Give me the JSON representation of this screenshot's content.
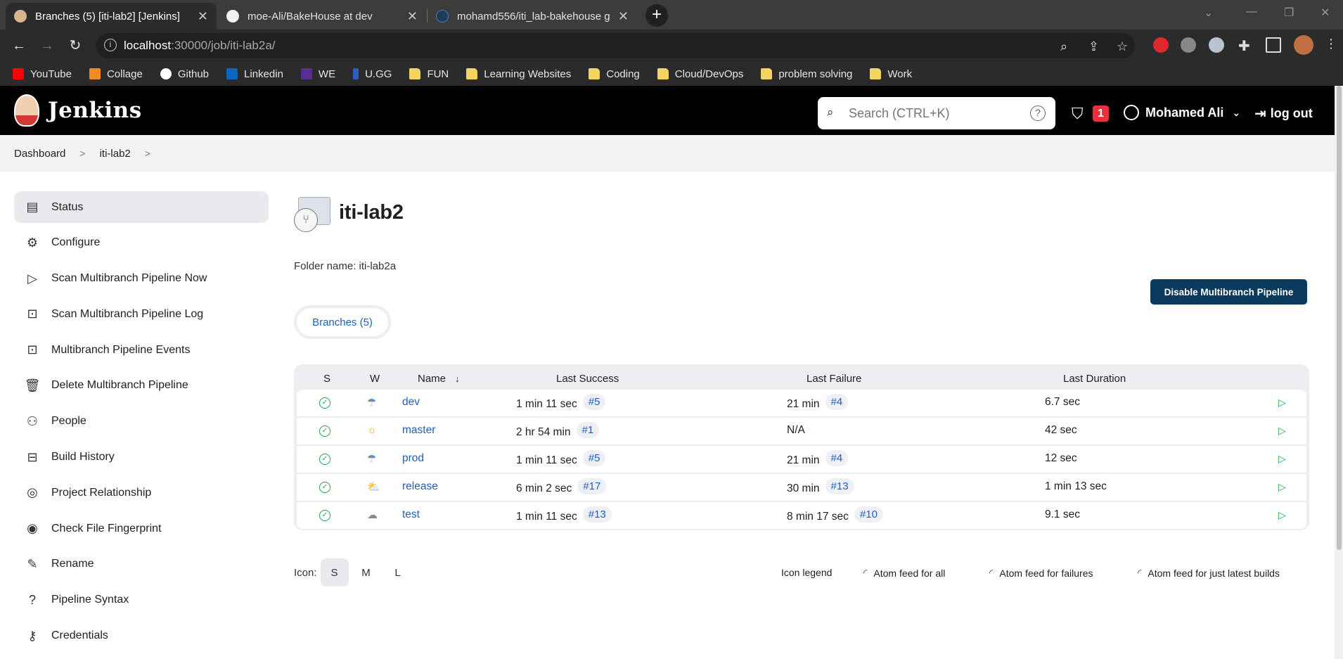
{
  "browser": {
    "tabs": [
      {
        "title": "Branches (5) [iti-lab2] [Jenkins]",
        "active": true
      },
      {
        "title": "moe-Ali/BakeHouse at dev",
        "active": false
      },
      {
        "title": "mohamd556/iti_lab-bakehouse g",
        "active": false
      }
    ],
    "new_tab": "+",
    "url_host": "localhost",
    "url_rest": ":30000/job/iti-lab2a/",
    "bookmarks": [
      {
        "label": "YouTube",
        "icon": "youtube-icon"
      },
      {
        "label": "Collage",
        "icon": "collage-icon"
      },
      {
        "label": "Github",
        "icon": "github-icon"
      },
      {
        "label": "Linkedin",
        "icon": "linkedin-icon"
      },
      {
        "label": "WE",
        "icon": "we-icon"
      },
      {
        "label": "U.GG",
        "icon": "ugg-icon"
      },
      {
        "label": "FUN",
        "icon": "folder-icon"
      },
      {
        "label": "Learning Websites",
        "icon": "folder-icon"
      },
      {
        "label": "Coding",
        "icon": "folder-icon"
      },
      {
        "label": "Cloud/DevOps",
        "icon": "folder-icon"
      },
      {
        "label": "problem solving",
        "icon": "folder-icon"
      },
      {
        "label": "Work",
        "icon": "folder-icon"
      }
    ]
  },
  "header": {
    "brand": "Jenkins",
    "search_placeholder": "Search (CTRL+K)",
    "alert_count": "1",
    "user": "Mohamed Ali",
    "logout": "log out"
  },
  "breadcrumb": [
    "Dashboard",
    "iti-lab2"
  ],
  "sidebar": {
    "items": [
      {
        "label": "Status",
        "icon": "status-icon",
        "active": true
      },
      {
        "label": "Configure",
        "icon": "gear-icon"
      },
      {
        "label": "Scan Multibranch Pipeline Now",
        "icon": "play-icon"
      },
      {
        "label": "Scan Multibranch Pipeline Log",
        "icon": "terminal-icon"
      },
      {
        "label": "Multibranch Pipeline Events",
        "icon": "terminal-icon"
      },
      {
        "label": "Delete Multibranch Pipeline",
        "icon": "trash-icon"
      },
      {
        "label": "People",
        "icon": "people-icon"
      },
      {
        "label": "Build History",
        "icon": "history-icon"
      },
      {
        "label": "Project Relationship",
        "icon": "relationship-icon"
      },
      {
        "label": "Check File Fingerprint",
        "icon": "fingerprint-icon"
      },
      {
        "label": "Rename",
        "icon": "pencil-icon"
      },
      {
        "label": "Pipeline Syntax",
        "icon": "help-icon"
      },
      {
        "label": "Credentials",
        "icon": "key-icon"
      }
    ]
  },
  "main": {
    "title": "iti-lab2",
    "folder_name": "Folder name: iti-lab2a",
    "disable_button": "Disable Multibranch Pipeline",
    "branches_tab": "Branches (5)",
    "columns": {
      "s": "S",
      "w": "W",
      "name": "Name",
      "sort": "↓",
      "last_success": "Last Success",
      "last_failure": "Last Failure",
      "last_duration": "Last Duration"
    },
    "rows": [
      {
        "name": "dev",
        "weather": "rain-icon",
        "success_time": "1 min 11 sec",
        "success_build": "#5",
        "failure_time": "21 min",
        "failure_build": "#4",
        "duration": "6.7 sec"
      },
      {
        "name": "master",
        "weather": "sun-icon",
        "success_time": "2 hr 54 min",
        "success_build": "#1",
        "failure_time": "N/A",
        "failure_build": "",
        "duration": "42 sec"
      },
      {
        "name": "prod",
        "weather": "rain-icon",
        "success_time": "1 min 11 sec",
        "success_build": "#5",
        "failure_time": "21 min",
        "failure_build": "#4",
        "duration": "12 sec"
      },
      {
        "name": "release",
        "weather": "partly-cloudy-icon",
        "success_time": "6 min 2 sec",
        "success_build": "#17",
        "failure_time": "30 min",
        "failure_build": "#13",
        "duration": "1 min 13 sec"
      },
      {
        "name": "test",
        "weather": "cloud-icon",
        "success_time": "1 min 11 sec",
        "success_build": "#13",
        "failure_time": "8 min 17 sec",
        "failure_build": "#10",
        "duration": "9.1 sec"
      }
    ],
    "icon_label": "Icon:",
    "icon_sizes": [
      "S",
      "M",
      "L"
    ],
    "icon_legend": "Icon legend",
    "feeds": [
      "Atom feed for all",
      "Atom feed for failures",
      "Atom feed for just latest builds"
    ]
  },
  "colors": {
    "accent": "#1e5fbf",
    "success": "#1ea64b",
    "header": "#000000",
    "button": "#0b3a5c"
  }
}
